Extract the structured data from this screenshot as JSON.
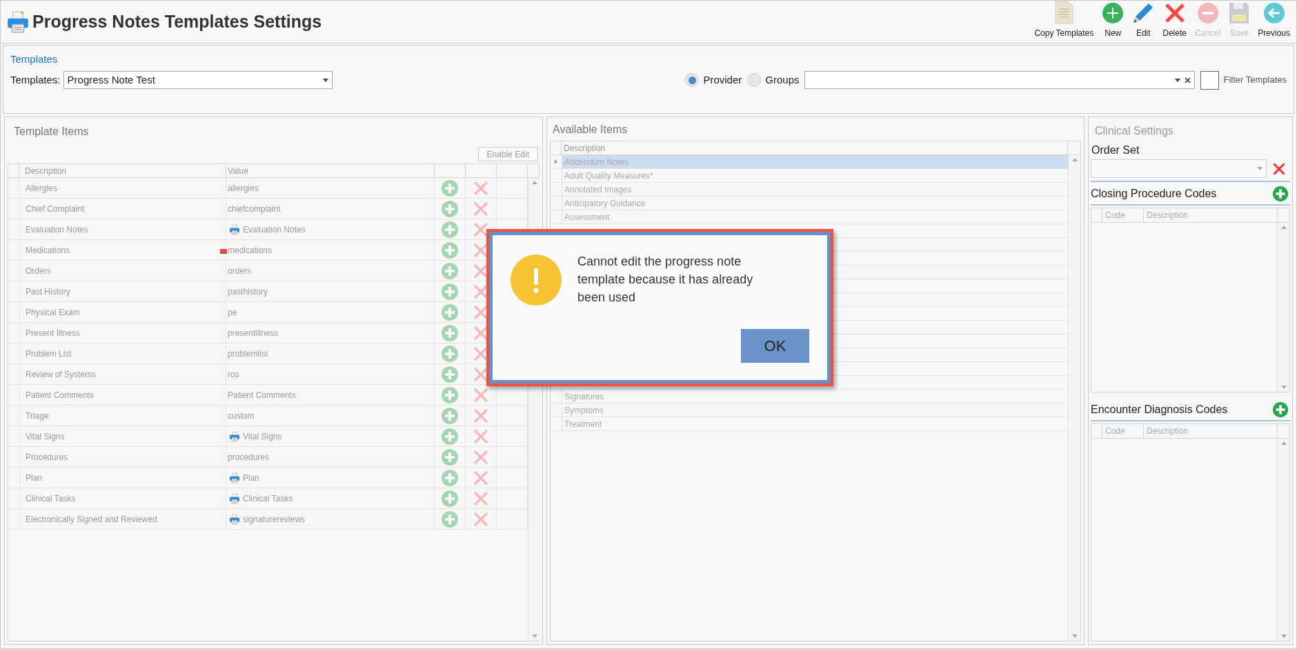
{
  "window": {
    "title": "Progress Notes Templates Settings"
  },
  "toolbar": [
    {
      "label": "Copy Templates",
      "kind": "copy",
      "disabled": false
    },
    {
      "label": "New",
      "kind": "new",
      "disabled": false
    },
    {
      "label": "Edit",
      "kind": "edit",
      "disabled": false
    },
    {
      "label": "Delete",
      "kind": "delete",
      "disabled": false
    },
    {
      "label": "Cancel",
      "kind": "cancel",
      "disabled": true
    },
    {
      "label": "Save",
      "kind": "save",
      "disabled": true
    },
    {
      "label": "Previous",
      "kind": "previous",
      "disabled": false
    }
  ],
  "templates_panel": {
    "heading": "Templates",
    "label": "Templates:",
    "value": "Progress Note Test",
    "radios": [
      {
        "label": "Provider",
        "selected": true
      },
      {
        "label": "Groups",
        "selected": false
      }
    ],
    "filter": {
      "label": "Filter Templates",
      "checked": false
    }
  },
  "template_items": {
    "title": "Template Items",
    "enable_edit": "Enable Edit",
    "disabled": true,
    "columns": [
      "Description",
      "Value"
    ],
    "rows": [
      {
        "description": "Allergies",
        "value": "allergies",
        "kind": "text",
        "flagged": false
      },
      {
        "description": "Chief Complaint",
        "value": "chiefcomplaint",
        "kind": "text",
        "flagged": false
      },
      {
        "description": "Evaluation Notes",
        "value": "Evaluation Notes",
        "kind": "report",
        "flagged": false
      },
      {
        "description": "Medications",
        "value": "medications",
        "kind": "text",
        "flagged": true
      },
      {
        "description": "Orders",
        "value": "orders",
        "kind": "text",
        "flagged": false
      },
      {
        "description": "Past History",
        "value": "pasthistory",
        "kind": "text",
        "flagged": false
      },
      {
        "description": "Physical Exam",
        "value": "pe",
        "kind": "text",
        "flagged": false
      },
      {
        "description": "Present Illness",
        "value": "presentillness",
        "kind": "text",
        "flagged": false
      },
      {
        "description": "Problem List",
        "value": "problemlist",
        "kind": "text",
        "flagged": false
      },
      {
        "description": "Review of Systems",
        "value": "ros",
        "kind": "text",
        "flagged": false
      },
      {
        "description": "Patient Comments",
        "value": "Patient Comments",
        "kind": "text",
        "flagged": false
      },
      {
        "description": "Triage",
        "value": "custom",
        "kind": "text",
        "flagged": false
      },
      {
        "description": "Vital Signs",
        "value": "Vital Signs",
        "kind": "report",
        "flagged": false
      },
      {
        "description": "Procedures",
        "value": "procedures",
        "kind": "text",
        "flagged": false
      },
      {
        "description": "Plan",
        "value": "Plan",
        "kind": "report",
        "flagged": false
      },
      {
        "description": "Clinical Tasks",
        "value": "Clinical Tasks",
        "kind": "report",
        "flagged": false
      },
      {
        "description": "Electronically Signed and Reviewed",
        "value": "signaturereviews",
        "kind": "report",
        "flagged": false
      }
    ]
  },
  "available_items": {
    "title": "Available Items",
    "disabled": true,
    "columns": [
      "Description"
    ],
    "rows": [
      {
        "description": "Addendum Notes",
        "selected": true
      },
      {
        "description": "Adult Quality Measures*",
        "selected": false
      },
      {
        "description": "Annotated Images",
        "selected": false
      },
      {
        "description": "Anticipatory Guidance",
        "selected": false
      },
      {
        "description": "Assessment",
        "selected": false
      },
      {
        "description": "Signatures",
        "selected": false
      },
      {
        "description": "Symptoms",
        "selected": false
      },
      {
        "description": "Treatment",
        "selected": false
      }
    ]
  },
  "clinical_settings": {
    "title": "Clinical Settings",
    "order_set": {
      "label": "Order Set"
    },
    "sections": [
      {
        "title": "Closing Procedure Codes",
        "columns": [
          "Code",
          "Description"
        ]
      },
      {
        "title": "Encounter Diagnosis Codes",
        "columns": [
          "Code",
          "Description"
        ]
      }
    ]
  },
  "dialog": {
    "message": "Cannot edit the progress note template because it has already been used",
    "button": "OK"
  }
}
